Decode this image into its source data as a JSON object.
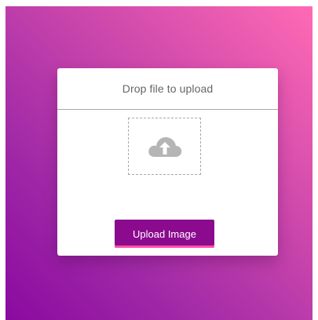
{
  "uploader": {
    "title": "Drop file to upload",
    "dropzone_icon": "cloud-upload-icon",
    "button_label": "Upload Image"
  },
  "colors": {
    "background_gradient_start": "#ff6ab4",
    "background_gradient_end": "#8a0aa0",
    "button_background": "#8b0a8e",
    "button_accent": "#ff4fa8",
    "icon_color": "#b5b5b5"
  }
}
